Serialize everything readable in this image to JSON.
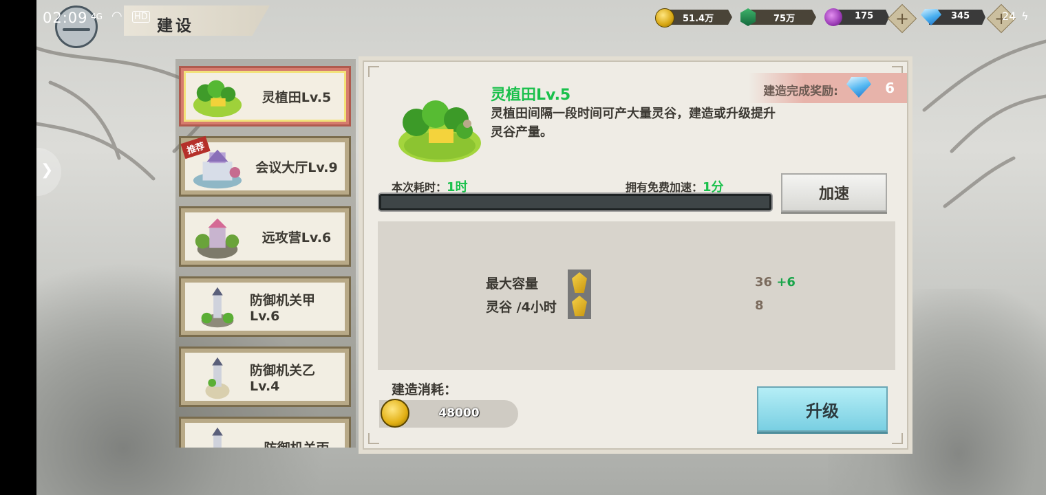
{
  "status": {
    "time": "02:09",
    "signal": "4G",
    "hd": "HD",
    "battery": "24"
  },
  "header": {
    "title": "建设"
  },
  "resources": {
    "gold": "51.4万",
    "jade": "75万",
    "orb": "175",
    "diamond": "345"
  },
  "buildings": [
    {
      "name": "灵植田Lv.5",
      "selected": true
    },
    {
      "name": "会议大厅Lv.9",
      "tag": "推荐"
    },
    {
      "name": "远攻营Lv.6"
    },
    {
      "name": "防御机关甲Lv.6"
    },
    {
      "name": "防御机关乙Lv.4"
    },
    {
      "name": "防御机关丙"
    }
  ],
  "detail": {
    "name": "灵植田Lv.5",
    "description": "灵植田间隔一段时间可产大量灵谷，建造或升级提升灵谷产量。",
    "reward_label": "建造完成奖励:",
    "reward_value": "6",
    "time_label": "本次耗时：",
    "time_value": "1时",
    "free_label": "拥有免费加速：",
    "free_value": "1分",
    "progress": 0,
    "speed_button": "加速",
    "stats": [
      {
        "label": "最大容量",
        "value": "36",
        "bonus": "+6"
      },
      {
        "label": "灵谷 /4小时",
        "value": "8",
        "bonus": ""
      }
    ],
    "cost_label": "建造消耗：",
    "cost_value": "48000",
    "upgrade_button": "升级"
  },
  "colors": {
    "accent_green": "#19c04b",
    "selected_border": "#f2e27a",
    "upgrade_button": "#79cfe2"
  }
}
